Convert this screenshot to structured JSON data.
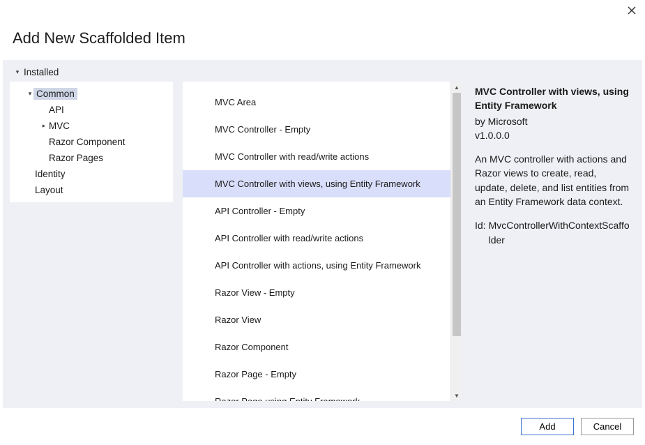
{
  "window": {
    "title": "Add New Scaffolded Item"
  },
  "tree": {
    "root": "Installed",
    "items": [
      {
        "label": "Common",
        "indent": 1,
        "selected": true,
        "expand": "down"
      },
      {
        "label": "API",
        "indent": 2,
        "expand": ""
      },
      {
        "label": "MVC",
        "indent": 2,
        "expand": "right"
      },
      {
        "label": "Razor Component",
        "indent": 2,
        "expand": ""
      },
      {
        "label": "Razor Pages",
        "indent": 2,
        "expand": ""
      },
      {
        "label": "Identity",
        "indent": 1,
        "expand": ""
      },
      {
        "label": "Layout",
        "indent": 1,
        "expand": ""
      }
    ]
  },
  "templates": [
    {
      "label": "MVC Area",
      "selected": false
    },
    {
      "label": "MVC Controller - Empty",
      "selected": false
    },
    {
      "label": "MVC Controller with read/write actions",
      "selected": false
    },
    {
      "label": "MVC Controller with views, using Entity Framework",
      "selected": true
    },
    {
      "label": "API Controller - Empty",
      "selected": false
    },
    {
      "label": "API Controller with read/write actions",
      "selected": false
    },
    {
      "label": "API Controller with actions, using Entity Framework",
      "selected": false
    },
    {
      "label": "Razor View - Empty",
      "selected": false
    },
    {
      "label": "Razor View",
      "selected": false
    },
    {
      "label": "Razor Component",
      "selected": false
    },
    {
      "label": "Razor Page - Empty",
      "selected": false
    },
    {
      "label": "Razor Page using Entity Framework",
      "selected": false
    }
  ],
  "details": {
    "title": "MVC Controller with views, using Entity Framework",
    "by": "by Microsoft",
    "version": "v1.0.0.0",
    "description": "An MVC controller with actions and Razor views to create, read, update, delete, and list entities from an Entity Framework data context.",
    "id_label": "Id:",
    "id_value": "MvcControllerWithContextScaffolder"
  },
  "buttons": {
    "add": "Add",
    "cancel": "Cancel"
  }
}
